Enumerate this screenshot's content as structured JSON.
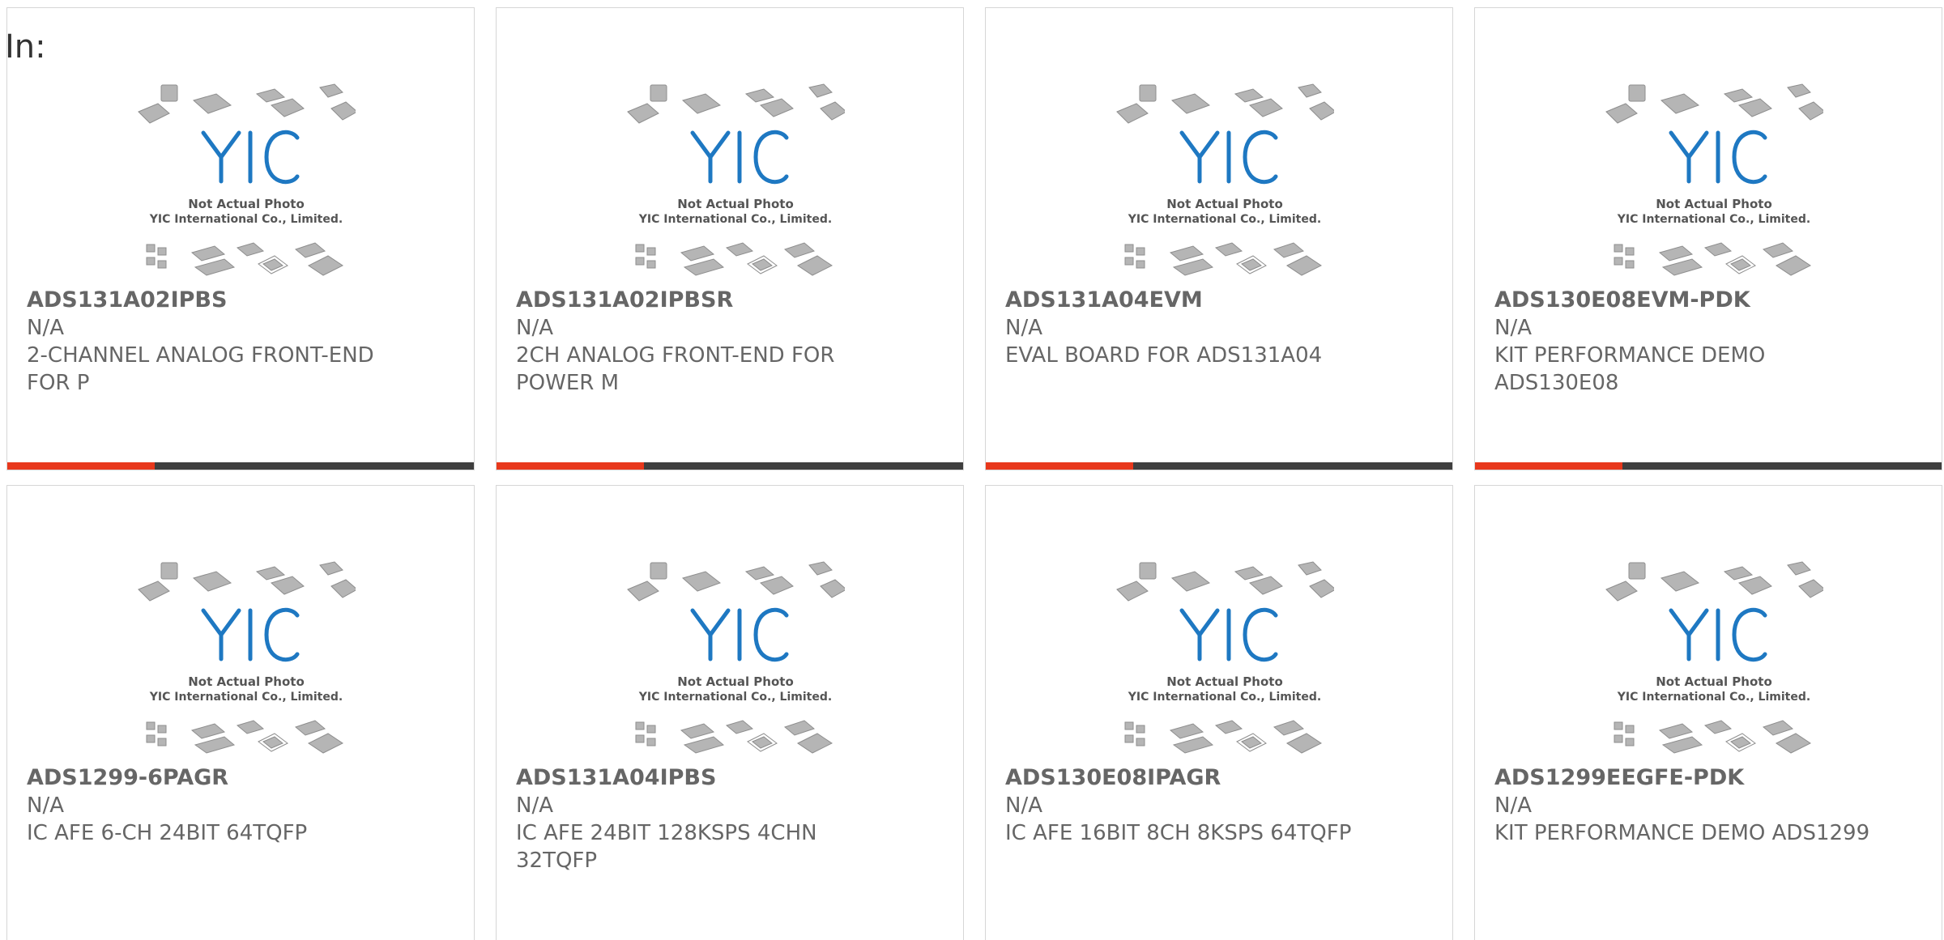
{
  "header": {
    "label": "In:"
  },
  "image_text": {
    "line1": "Not Actual Photo",
    "line2": "YIC International Co., Limited."
  },
  "colors": {
    "accent": "#e8381c",
    "bar": "#3f3f3f",
    "logo_blue": "#1e78c2",
    "text": "#666666"
  },
  "products": [
    {
      "part": "ADS131A02IPBS",
      "mfr": "N/A",
      "desc": "2-CHANNEL ANALOG FRONT-END FOR P"
    },
    {
      "part": "ADS131A02IPBSR",
      "mfr": "N/A",
      "desc": "2CH ANALOG FRONT-END FOR POWER M"
    },
    {
      "part": "ADS131A04EVM",
      "mfr": "N/A",
      "desc": "EVAL BOARD FOR ADS131A04"
    },
    {
      "part": "ADS130E08EVM-PDK",
      "mfr": "N/A",
      "desc": "KIT PERFORMANCE DEMO ADS130E08"
    },
    {
      "part": "ADS1299-6PAGR",
      "mfr": "N/A",
      "desc": "IC AFE 6-CH 24BIT 64TQFP"
    },
    {
      "part": "ADS131A04IPBS",
      "mfr": "N/A",
      "desc": "IC AFE 24BIT 128KSPS 4CHN 32TQFP"
    },
    {
      "part": "ADS130E08IPAGR",
      "mfr": "N/A",
      "desc": "IC AFE 16BIT 8CH 8KSPS 64TQFP"
    },
    {
      "part": "ADS1299EEGFE-PDK",
      "mfr": "N/A",
      "desc": "KIT PERFORMANCE DEMO ADS1299"
    }
  ]
}
